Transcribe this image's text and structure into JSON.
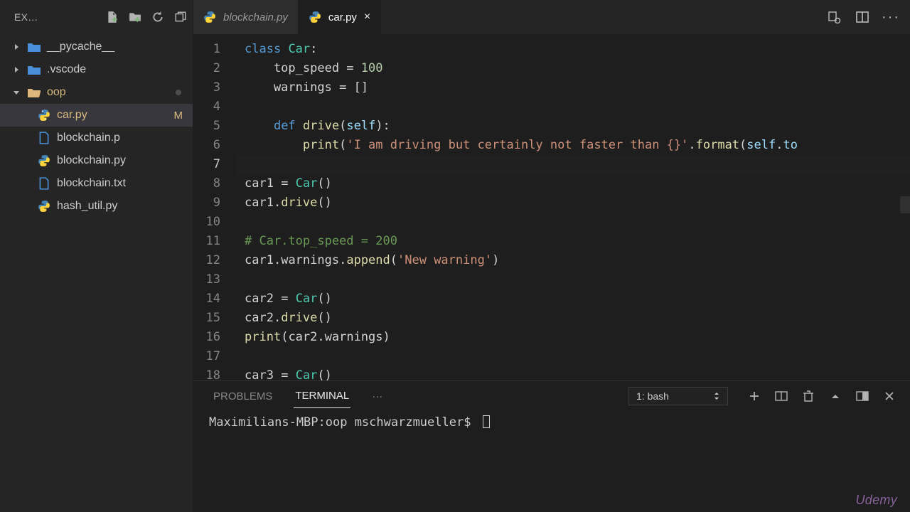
{
  "explorer": {
    "title": "EX…",
    "tree": [
      {
        "label": "__pycache__"
      },
      {
        "label": ".vscode"
      },
      {
        "label": "oop"
      },
      {
        "label": "car.py",
        "badge": "M"
      },
      {
        "label": "blockchain.p"
      },
      {
        "label": "blockchain.py"
      },
      {
        "label": "blockchain.txt"
      },
      {
        "label": "hash_util.py"
      }
    ]
  },
  "tabs": {
    "inactive": "blockchain.py",
    "active": "car.py"
  },
  "code": {
    "lines_count": 18,
    "current_line": 7,
    "l5_self": "self",
    "l6_str": "'I am driving but certainly not faster than {}'",
    "l6_tail": ".to",
    "l11_cmt": "# Car.top_speed = 200",
    "l12_str": "'New warning'"
  },
  "panel": {
    "tabs": {
      "problems": "PROBLEMS",
      "terminal": "TERMINAL",
      "more": "···"
    },
    "select": "1: bash",
    "prompt": "Maximilians-MBP:oop mschwarzmueller$"
  },
  "watermark": "Udemy"
}
